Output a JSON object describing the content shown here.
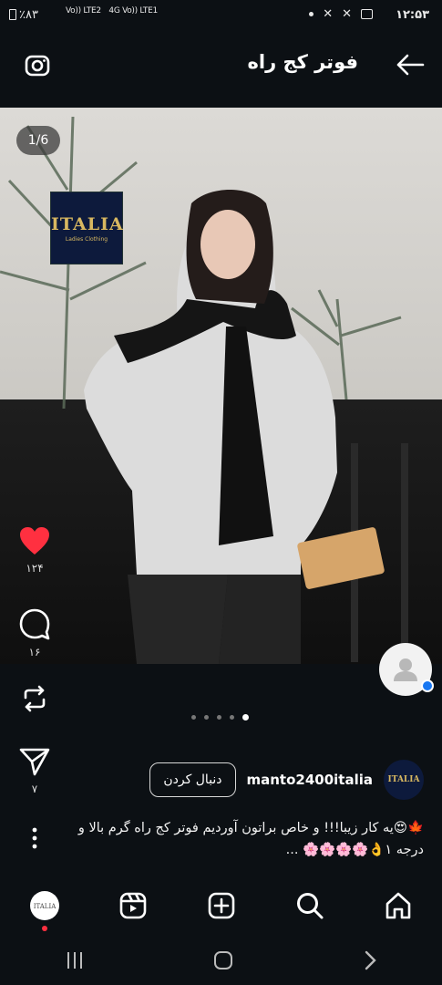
{
  "status_bar": {
    "battery": "٪۸۳",
    "network_1": "Vo)) LTE2",
    "network_2": "4G Vo)) LTE1",
    "time": "۱۲:۵۳"
  },
  "header": {
    "title": "فوتر کج راه",
    "back_icon": "arrow-left-icon",
    "camera_icon": "camera-icon"
  },
  "post": {
    "image_counter": "1/6",
    "watermark_brand": "ITALIA",
    "watermark_sub": "Ladies Clothing",
    "likes": "۱۲۴",
    "comments": "۱۶",
    "shares": "۷",
    "like_icon_color": "#ff3040",
    "carousel_dots": 5,
    "carousel_active": 4
  },
  "author": {
    "username": "manto2400italia",
    "follow_label": "دنبال کردن",
    "avatar_text": "ITALIA"
  },
  "caption": {
    "line1": "🍁😍یه کار زیبا!!! و خاص براتون آوردیم فوتر کج راه گرم بالا و",
    "line2": "درجه ۱👌🌸🌸🌸🌸 ..."
  },
  "bottom_nav": {
    "items": [
      "profile",
      "reels",
      "create",
      "search",
      "home"
    ]
  }
}
